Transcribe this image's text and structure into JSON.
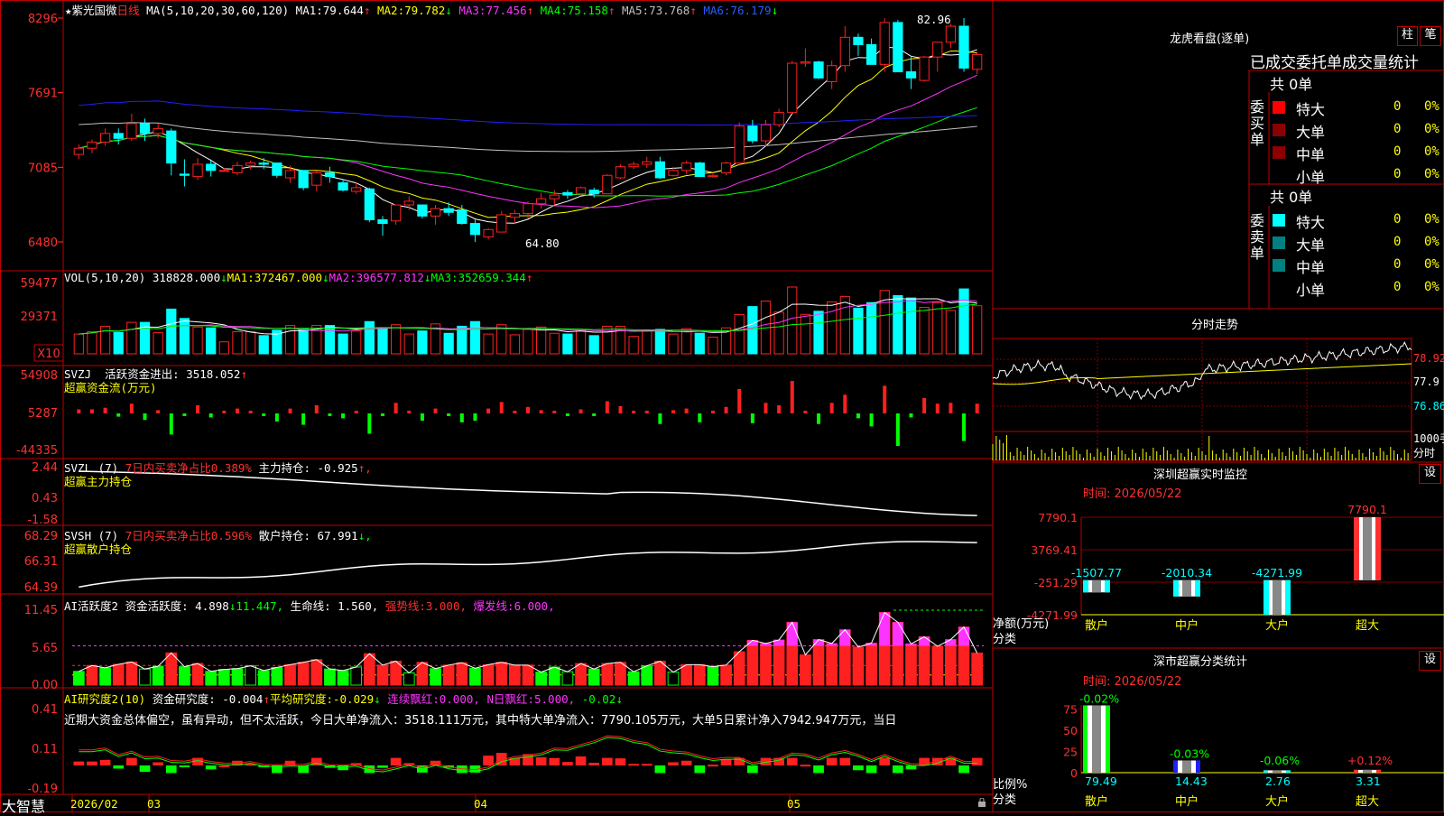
{
  "colors": {
    "up": "#ff2020",
    "down": "#00ffff",
    "ma1": "#ffffff",
    "ma2": "#ffff00",
    "ma3": "#ff33ff",
    "ma4": "#00ff00",
    "ma5": "#c0c0c0",
    "ma6": "#2020ff",
    "border": "#c00000",
    "grid": "#800000"
  },
  "header": {
    "star": "★",
    "name": "紫光国微",
    "period": "日线",
    "ma_label": "MA(5,10,20,30,60,120)",
    "ma_values": [
      {
        "label": "MA1:",
        "value": "79.644",
        "arrow": "↑"
      },
      {
        "label": "MA2:",
        "value": "79.782",
        "arrow": "↓"
      },
      {
        "label": "MA3:",
        "value": "77.456",
        "arrow": "↑"
      },
      {
        "label": "MA4:",
        "value": "75.158",
        "arrow": "↑"
      },
      {
        "label": "MA5:",
        "value": "73.768",
        "arrow": "↑"
      },
      {
        "label": "MA6:",
        "value": "76.179",
        "arrow": "↓"
      }
    ],
    "high_note": "82.96",
    "low_note": "64.80"
  },
  "price_axis": [
    "8296",
    "7691",
    "7085",
    "6480"
  ],
  "vol": {
    "label": "VOL(5,10,20)",
    "value": "318828.000",
    "arrow": "↓",
    "ma": [
      {
        "label": "MA1:",
        "value": "372467.000",
        "arrow": "↓"
      },
      {
        "label": "MA2:",
        "value": "396577.812",
        "arrow": "↓"
      },
      {
        "label": "MA3:",
        "value": "352659.344",
        "arrow": "↑"
      }
    ],
    "axis": [
      "59477",
      "29371"
    ],
    "unit": "X10"
  },
  "svzj": {
    "label": "SVZJ",
    "t1": "活跃资金进出:",
    "v1": "3518.052",
    "a1": "↑",
    "sub": "超赢资金流(万元)",
    "axis": [
      "54908",
      "5287",
      "-44335"
    ]
  },
  "svzl": {
    "label": "SVZL (7)",
    "t1": "7日内买卖净占比0.389%",
    "t2": "主力持仓:",
    "v2": "-0.925",
    "a2": "↑,",
    "sub": "超赢主力持仓",
    "axis": [
      "2.44",
      "0.43",
      "-1.58"
    ]
  },
  "svsh": {
    "label": "SVSH (7)",
    "t1": "7日内买卖净占比0.596%",
    "t2": "散户持仓:",
    "v2": "67.991",
    "a2": "↓,",
    "sub": "超赢散户持仓",
    "axis": [
      "68.29",
      "66.31",
      "64.39"
    ]
  },
  "ai1": {
    "label": "AI活跃度2",
    "t1": "资金活跃度:",
    "v1": "4.898",
    "a1": "↓",
    "v2": "11.447,",
    "t3": "生命线:",
    "v3": "1.560,",
    "t4": "强势线:",
    "v4": "3.000,",
    "t5": "爆发线:",
    "v5": "6.000,",
    "axis": [
      "11.45",
      "5.65",
      "0.00"
    ]
  },
  "ai2": {
    "label": "AI研究度2(10)",
    "t1": "资金研究度:",
    "v1": "-0.004",
    "a1": "↑",
    "t2": "平均研究度:",
    "v2": "-0.029",
    "a2": "↓",
    "t3": "连续飘红:",
    "v3": "0.000,",
    "t4": "N日飘红:",
    "v4": "5.000,",
    "v5": "-0.02",
    "a5": "↓",
    "desc": "近期大资金总体偏空，虽有异动，但不太活跃，今日大单净流入：3518.111万元，其中特大单净流入：7790.105万元，大单5日累计净入7942.947万元，当日",
    "axis": [
      "0.41",
      "0.11",
      "-0.19"
    ]
  },
  "xaxis": {
    "brand": "大智慧",
    "labels": [
      "2026/02",
      "03",
      "04",
      "05"
    ]
  },
  "lhb": {
    "title": "龙虎看盘(逐单)",
    "btn1": "柱",
    "btn2": "笔",
    "tabs": "已成交委托单成交量统计",
    "buy": {
      "side": "委买单",
      "total": "共 0单",
      "rows": [
        {
          "name": "特大",
          "v": "0",
          "p": "0%"
        },
        {
          "name": "大单",
          "v": "0",
          "p": "0%"
        },
        {
          "name": "中单",
          "v": "0",
          "p": "0%"
        },
        {
          "name": "小单",
          "v": "0",
          "p": "0%"
        }
      ]
    },
    "sell": {
      "side": "委卖单",
      "total": "共 0单",
      "rows": [
        {
          "name": "特大",
          "v": "0",
          "p": "0%"
        },
        {
          "name": "大单",
          "v": "0",
          "p": "0%"
        },
        {
          "name": "中单",
          "v": "0",
          "p": "0%"
        },
        {
          "name": "小单",
          "v": "0",
          "p": "0%"
        }
      ]
    }
  },
  "fs": {
    "title": "分时走势",
    "axis": [
      "78.92",
      "77.9",
      "76.86",
      "1000手",
      "分时"
    ]
  },
  "monitor": {
    "title": "深圳超赢实时监控",
    "btn": "设",
    "time": "时间: 2026/05/22",
    "axis": [
      "7790.1",
      "3769.41",
      "-251.29",
      "-4271.99"
    ],
    "ylabel": "净额(万元)",
    "xlabel": "分类"
  },
  "stats": {
    "title": "深市超赢分类统计",
    "btn": "设",
    "time": "时间: 2026/05/22",
    "axis": [
      "75",
      "50",
      "25",
      "0"
    ],
    "ylabel": "比例%",
    "xlabel": "分类"
  },
  "chart_data": [
    {
      "type": "bar",
      "title": "深圳超赢实时监控",
      "ylabel": "净额(万元)",
      "xlabel": "分类",
      "categories": [
        "散户",
        "中户",
        "大户",
        "超大"
      ],
      "values": [
        -1507.77,
        -2010.34,
        -4271.99,
        7790.1
      ],
      "ylim": [
        -4271.99,
        7790.1
      ]
    },
    {
      "type": "bar",
      "title": "深市超赢分类统计",
      "ylabel": "比例%",
      "xlabel": "分类",
      "categories": [
        "散户",
        "中户",
        "大户",
        "超大"
      ],
      "values": [
        79.49,
        14.43,
        2.76,
        3.31
      ],
      "change_labels": [
        "-0.02%",
        "-0.03%",
        "-0.06%",
        "+0.12%"
      ],
      "ylim": [
        0,
        80
      ]
    },
    {
      "type": "candlestick",
      "title": "紫光国微 日线",
      "y_axis_ticks": [
        8296,
        7691,
        7085,
        6480
      ],
      "candles": [
        [
          71.9,
          72.7,
          71.5,
          72.4
        ],
        [
          72.4,
          73.1,
          72.0,
          72.9
        ],
        [
          72.9,
          74.0,
          72.6,
          73.6
        ],
        [
          73.6,
          74.0,
          72.7,
          73.2
        ],
        [
          73.2,
          75.2,
          73.0,
          74.4
        ],
        [
          74.4,
          74.8,
          73.0,
          73.6
        ],
        [
          73.6,
          74.4,
          73.2,
          74.0
        ],
        [
          73.8,
          74.0,
          70.2,
          71.2
        ],
        [
          70.3,
          71.5,
          69.3,
          70.2
        ],
        [
          70.1,
          71.6,
          69.8,
          71.1
        ],
        [
          71.1,
          71.4,
          70.1,
          70.6
        ],
        [
          70.6,
          70.8,
          70.6,
          70.6
        ],
        [
          70.4,
          71.3,
          70.2,
          71.0
        ],
        [
          71.0,
          71.4,
          70.7,
          71.2
        ],
        [
          71.2,
          71.6,
          70.7,
          71.1
        ],
        [
          71.2,
          71.2,
          70.0,
          70.2
        ],
        [
          70.0,
          71.0,
          69.6,
          70.6
        ],
        [
          70.6,
          70.6,
          69.0,
          69.2
        ],
        [
          69.4,
          70.6,
          68.9,
          70.4
        ],
        [
          70.4,
          70.9,
          69.6,
          70.1
        ],
        [
          69.6,
          69.8,
          68.9,
          69.0
        ],
        [
          68.9,
          69.6,
          68.7,
          69.2
        ],
        [
          69.1,
          69.2,
          66.4,
          66.6
        ],
        [
          66.6,
          66.9,
          65.3,
          66.3
        ],
        [
          66.5,
          67.8,
          66.2,
          67.8
        ],
        [
          67.8,
          68.5,
          67.4,
          68.1
        ],
        [
          67.8,
          67.8,
          66.7,
          66.9
        ],
        [
          66.9,
          67.8,
          66.2,
          67.5
        ],
        [
          67.5,
          68.0,
          66.9,
          67.2
        ],
        [
          67.4,
          67.8,
          66.2,
          66.3
        ],
        [
          66.3,
          66.6,
          64.8,
          65.4
        ],
        [
          65.2,
          65.9,
          65.0,
          65.8
        ],
        [
          65.6,
          67.3,
          65.6,
          67.0
        ],
        [
          66.8,
          67.4,
          66.3,
          67.1
        ],
        [
          67.1,
          68.1,
          66.7,
          67.9
        ],
        [
          67.9,
          68.8,
          67.5,
          68.3
        ],
        [
          68.3,
          69.0,
          67.8,
          68.6
        ],
        [
          68.8,
          69.0,
          68.3,
          68.6
        ],
        [
          68.7,
          69.3,
          68.6,
          69.2
        ],
        [
          69.0,
          69.2,
          68.4,
          68.7
        ],
        [
          68.7,
          70.3,
          68.7,
          70.2
        ],
        [
          70.0,
          71.1,
          69.9,
          70.9
        ],
        [
          70.9,
          71.3,
          70.7,
          71.1
        ],
        [
          71.1,
          71.7,
          70.8,
          71.3
        ],
        [
          71.3,
          71.7,
          69.9,
          70.0
        ],
        [
          70.2,
          70.9,
          70.1,
          70.6
        ],
        [
          70.6,
          71.4,
          70.3,
          71.2
        ],
        [
          71.2,
          71.3,
          70.1,
          70.1
        ],
        [
          70.1,
          70.3,
          70.0,
          70.2
        ],
        [
          70.4,
          71.3,
          70.2,
          71.2
        ],
        [
          71.2,
          74.5,
          71.0,
          74.2
        ],
        [
          74.2,
          74.7,
          72.8,
          73.0
        ],
        [
          73.0,
          74.7,
          72.5,
          74.3
        ],
        [
          74.3,
          75.6,
          74.1,
          75.3
        ],
        [
          75.3,
          79.5,
          75.2,
          79.3
        ],
        [
          79.3,
          80.5,
          79.0,
          79.4
        ],
        [
          79.4,
          79.5,
          78.0,
          78.1
        ],
        [
          77.8,
          79.5,
          77.2,
          79.1
        ],
        [
          79.1,
          82.3,
          78.6,
          81.4
        ],
        [
          81.4,
          81.7,
          79.9,
          80.8
        ],
        [
          80.8,
          81.3,
          79.2,
          79.2
        ],
        [
          79.2,
          82.96,
          78.6,
          82.6
        ],
        [
          82.6,
          82.8,
          79.5,
          78.6
        ],
        [
          78.6,
          79.8,
          77.2,
          78.1
        ],
        [
          77.9,
          79.9,
          77.8,
          79.8
        ],
        [
          79.8,
          80.9,
          78.6,
          81.0
        ],
        [
          81.0,
          82.5,
          80.5,
          82.3
        ],
        [
          82.3,
          82.96,
          78.6,
          78.9
        ],
        [
          78.8,
          80.2,
          78.4,
          80.0
        ]
      ]
    }
  ]
}
